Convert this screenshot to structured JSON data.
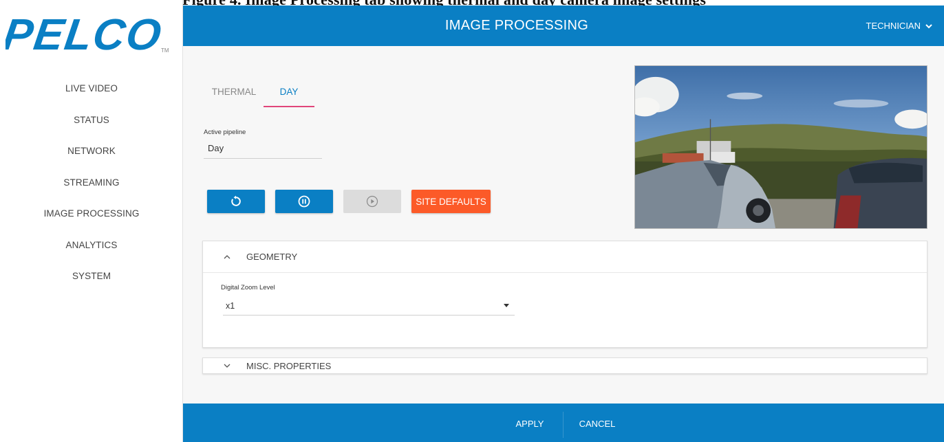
{
  "caption_fragment": "Figure 4. Image Processing tab showing thermal and day camera image settings",
  "brand": {
    "logo_text": "PELCO",
    "trademark": "TM"
  },
  "sidebar": {
    "items": [
      {
        "label": "LIVE VIDEO"
      },
      {
        "label": "STATUS"
      },
      {
        "label": "NETWORK"
      },
      {
        "label": "STREAMING"
      },
      {
        "label": "IMAGE PROCESSING"
      },
      {
        "label": "ANALYTICS"
      },
      {
        "label": "SYSTEM"
      }
    ]
  },
  "header": {
    "title": "IMAGE PROCESSING",
    "user": "TECHNICIAN"
  },
  "tabs": [
    {
      "label": "THERMAL",
      "active": false
    },
    {
      "label": "DAY",
      "active": true
    }
  ],
  "pipeline": {
    "label": "Active pipeline",
    "value": "Day"
  },
  "controls": {
    "reset_icon": "refresh-icon",
    "pause_icon": "pause-circle-icon",
    "play_icon": "play-circle-icon",
    "site_defaults_label": "SITE DEFAULTS"
  },
  "sections": {
    "geometry": {
      "title": "GEOMETRY",
      "expanded": true,
      "zoom_label": "Digital Zoom Level",
      "zoom_value": "x1"
    },
    "misc": {
      "title": "MISC. PROPERTIES",
      "expanded": false
    }
  },
  "footer": {
    "apply_label": "APPLY",
    "cancel_label": "CANCEL"
  },
  "colors": {
    "primary": "#0a7fc4",
    "accent_tab": "#e0457a",
    "site_defaults": "#fc5a28",
    "disabled": "#dcdcdc"
  }
}
